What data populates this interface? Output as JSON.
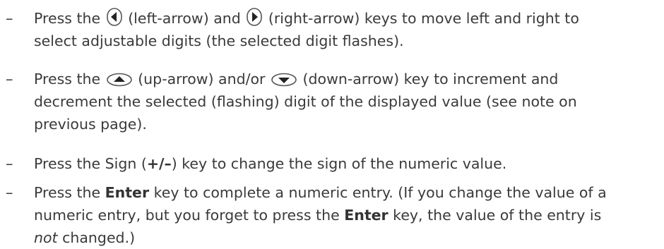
{
  "instructions": {
    "items": [
      {
        "dash": "–",
        "p1": "Press the",
        "left_key_label": "(left-arrow) and",
        "right_key_label": "(right-arrow) keys to move left and right to",
        "line2": "select adjustable digits (the selected digit flashes)."
      },
      {
        "dash": "–",
        "p1": "Press the",
        "up_key_label": "(up-arrow) and/or",
        "down_key_label": "(down-arrow) key to increment and",
        "line2": "decrement the selected (flashing) digit of the displayed value (see note on",
        "line3": "previous page)."
      },
      {
        "dash": "–",
        "p1": "Press the Sign (",
        "sign_key": "+/–",
        "p2": ") key to change the sign of the numeric value."
      },
      {
        "dash": "–",
        "p1": "Press the",
        "enter_key": "Enter",
        "p2": "key to complete a numeric entry. (If you change the value of a",
        "p3": "numeric entry, but you forget to press the",
        "enter_key_2": "Enter",
        "p4": "key, the value of the entry is",
        "not_word": "not",
        "p5": "changed.)"
      }
    ]
  },
  "icons": {
    "left": "left-arrow-key-icon",
    "right": "right-arrow-key-icon",
    "up": "up-arrow-key-icon",
    "down": "down-arrow-key-icon"
  }
}
